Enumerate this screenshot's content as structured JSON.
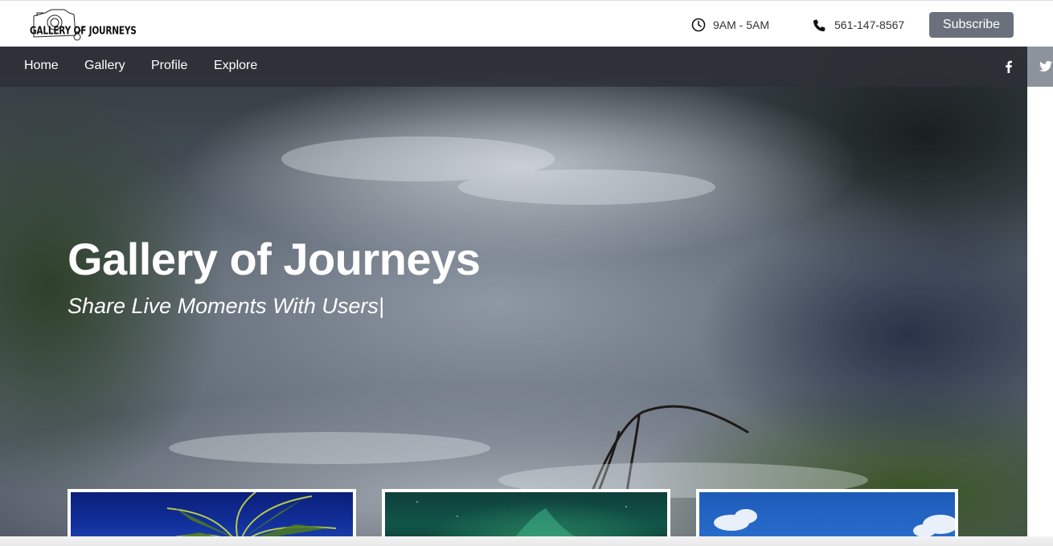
{
  "header": {
    "logo_text": "GALLERY OF JOURNEYS",
    "hours_text": "9AM - 5AM",
    "phone_text": "561-147-8567",
    "subscribe_label": "Subscribe",
    "hours_icon": "clock-icon",
    "phone_icon": "phone-icon"
  },
  "nav": {
    "items": [
      {
        "label": "Home"
      },
      {
        "label": "Gallery"
      },
      {
        "label": "Profile"
      },
      {
        "label": "Explore"
      }
    ],
    "social": [
      "facebook-icon",
      "twitter-icon"
    ]
  },
  "hero": {
    "title": "Gallery of Journeys",
    "subtitle": "Share Live Moments With Users|"
  },
  "cards": [
    {
      "image": "palm-tree-photo"
    },
    {
      "image": "aurora-photo"
    },
    {
      "image": "sky-building-photo"
    }
  ],
  "colors": {
    "subscribe_bg": "#6b717c",
    "nav_bg": "#2d3036",
    "twitter_box": "#8c939d"
  }
}
